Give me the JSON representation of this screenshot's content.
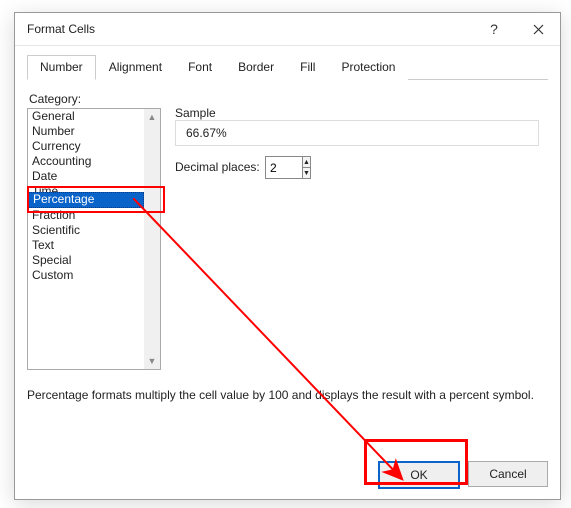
{
  "dialog": {
    "title": "Format Cells"
  },
  "tabs": {
    "number": "Number",
    "alignment": "Alignment",
    "font": "Font",
    "border": "Border",
    "fill": "Fill",
    "protection": "Protection"
  },
  "labels": {
    "category": "Category:",
    "sample": "Sample",
    "decimal_places": "Decimal places:"
  },
  "category_list": [
    "General",
    "Number",
    "Currency",
    "Accounting",
    "Date",
    "Time",
    "Percentage",
    "Fraction",
    "Scientific",
    "Text",
    "Special",
    "Custom"
  ],
  "selected_index": 6,
  "sample_value": "66.67%",
  "decimal_places_value": "2",
  "description": "Percentage formats multiply the cell value by 100 and displays the result with a percent symbol.",
  "buttons": {
    "ok": "OK",
    "cancel": "Cancel"
  }
}
